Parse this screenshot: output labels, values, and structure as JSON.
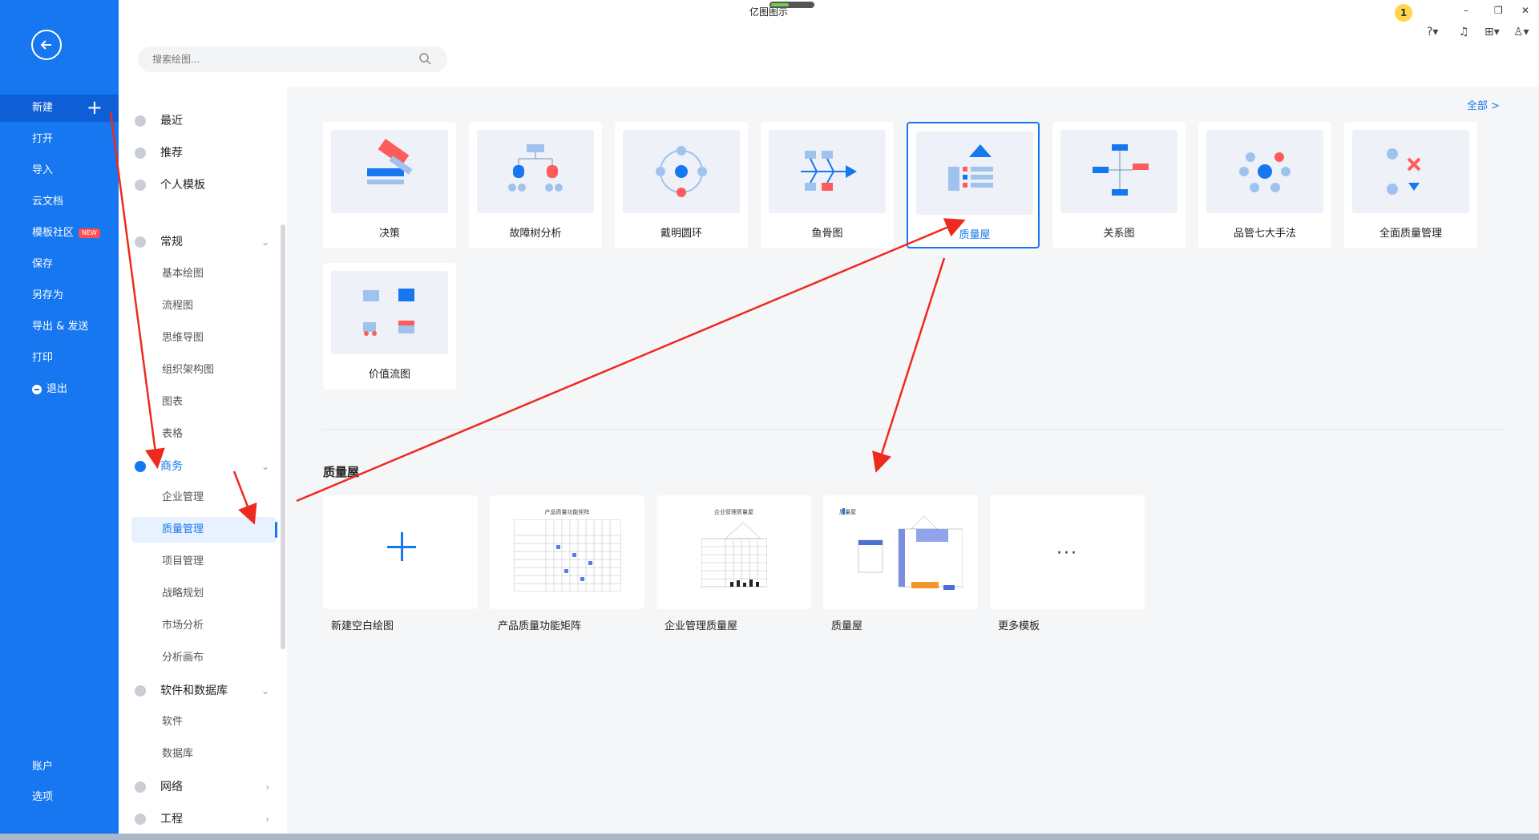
{
  "app": {
    "title": "亿图图示"
  },
  "search": {
    "placeholder": "搜索绘图..."
  },
  "rail": {
    "items": [
      {
        "label": "新建"
      },
      {
        "label": "打开"
      },
      {
        "label": "导入"
      },
      {
        "label": "云文档"
      },
      {
        "label": "模板社区",
        "badge": "NEW"
      },
      {
        "label": "保存"
      },
      {
        "label": "另存为"
      },
      {
        "label": "导出 & 发送"
      },
      {
        "label": "打印"
      },
      {
        "label": "退出"
      }
    ],
    "bottom": [
      {
        "label": "账户"
      },
      {
        "label": "选项"
      }
    ]
  },
  "sidebar": {
    "top": [
      {
        "label": "最近"
      },
      {
        "label": "推荐"
      },
      {
        "label": "个人模板"
      }
    ],
    "general": {
      "label": "常规",
      "subs": [
        "基本绘图",
        "流程图",
        "思维导图",
        "组织架构图",
        "图表",
        "表格"
      ]
    },
    "business": {
      "label": "商务",
      "subs": [
        "企业管理",
        "质量管理",
        "项目管理",
        "战略规划",
        "市场分析",
        "分析画布"
      ]
    },
    "software": {
      "label": "软件和数据库",
      "subs": [
        "软件",
        "数据库"
      ]
    },
    "network": {
      "label": "网络"
    },
    "engineering": {
      "label": "工程"
    }
  },
  "content": {
    "all_link": "全部 >",
    "types": [
      "决策",
      "故障树分析",
      "戴明圆环",
      "鱼骨图",
      "质量屋",
      "关系图",
      "品管七大手法",
      "全面质量管理",
      "价值流图"
    ],
    "section_title": "质量屋",
    "templates": [
      {
        "label": "新建空白绘图"
      },
      {
        "label": "产品质量功能矩阵",
        "thumb_title": "产品质量功能矩阵"
      },
      {
        "label": "企业管理质量屋",
        "thumb_title": "企业管理质量屋"
      },
      {
        "label": "质量屋",
        "thumb_title": "质量屋"
      },
      {
        "label": "更多模板"
      }
    ]
  },
  "colors": {
    "accent": "#1677f0",
    "annotation": "#ee2a1f"
  }
}
